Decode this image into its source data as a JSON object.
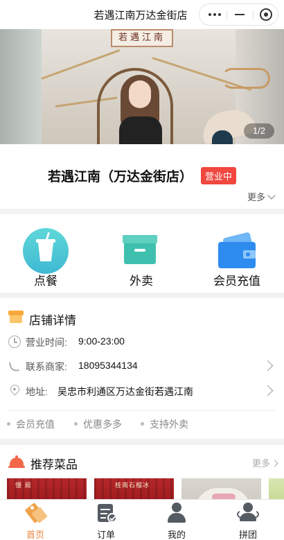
{
  "window": {
    "title": "若遇江南万达金街店",
    "capsule": {
      "more_icon": "more-dots-icon",
      "minimize_icon": "minimize-icon",
      "close_icon": "target-close-icon"
    }
  },
  "banner": {
    "sign_text": "若遇江南",
    "pager": "1/2"
  },
  "store": {
    "name": "若遇江南（万达金街店）",
    "status_badge": "营业中",
    "more_label": "更多"
  },
  "services": [
    {
      "label": "点餐",
      "icon": "drink-cup-icon"
    },
    {
      "label": "外卖",
      "icon": "delivery-box-icon"
    },
    {
      "label": "会员充值",
      "icon": "wallet-icon"
    }
  ],
  "details": {
    "title": "店铺详情",
    "hours_label": "营业时间:",
    "hours_value": "9:00-23:00",
    "phone_label": "联系商家:",
    "phone_value": "18095344134",
    "address_label": "地址:",
    "address_value": "吴忠市利通区万达金街若遇江南",
    "tags": [
      "会员充值",
      "优惠多多",
      "支持外卖"
    ]
  },
  "recommended": {
    "title": "推荐菜品",
    "more_label": "更多",
    "thumb_captions": [
      "慢 殿",
      "桂南石榴冰"
    ]
  },
  "tabbar": {
    "tabs": [
      {
        "label": "首页",
        "icon": "home-tag-icon",
        "active": true
      },
      {
        "label": "订单",
        "icon": "order-list-icon",
        "active": false
      },
      {
        "label": "我的",
        "icon": "user-icon",
        "active": false
      },
      {
        "label": "拼团",
        "icon": "group-buy-icon",
        "active": false
      }
    ]
  },
  "colors": {
    "accent": "#e9833a",
    "badge": "#f0473f",
    "order_gradient": [
      "#5fd7d8",
      "#3fb9d3"
    ],
    "takeout": "#3fc0ae",
    "wallet": "#2e8bef"
  }
}
